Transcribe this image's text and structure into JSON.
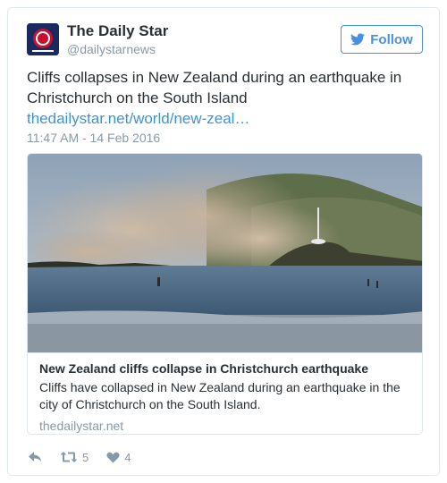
{
  "author": {
    "display_name": "The Daily Star",
    "screen_name": "@dailystarnews",
    "avatar_icon": "daily-star-logo-icon"
  },
  "follow_button": {
    "label": "Follow",
    "icon": "twitter-bird-icon",
    "color": "#4a90e2"
  },
  "tweet": {
    "text": "Cliffs collapses in New Zealand during an earthquake in Christchurch on the South Island ",
    "link": "thedailystar.net/world/new-zeal…",
    "timestamp": "11:47 AM - 14 Feb 2016"
  },
  "link_card": {
    "image_alt_icon": "cliff-collapse-photo",
    "title": "New Zealand cliffs collapse in Christchurch earthquake",
    "description": "Cliffs have collapsed in New Zealand during an earthquake in the city of Christchurch on the South Island.",
    "domain": "thedailystar.net"
  },
  "actions": {
    "reply_icon": "reply-icon",
    "retweet_icon": "retweet-icon",
    "retweet_count": "5",
    "like_icon": "heart-icon",
    "like_count": "4"
  },
  "colors": {
    "link": "#3b94d9",
    "muted": "#8899a6",
    "border": "#e1e8ed"
  }
}
